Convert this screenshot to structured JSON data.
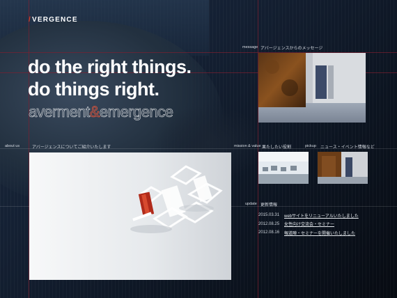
{
  "brand": {
    "logo_slash": "/",
    "logo_text": "VERGENCE"
  },
  "hero": {
    "headline_line1": "do the right things.",
    "headline_line2": "do things right.",
    "tagline_part1": "averment",
    "tagline_amp": "&",
    "tagline_part2": "emergence"
  },
  "sections": {
    "message": {
      "label": "message",
      "title": "アバージェンスからのメッセージ"
    },
    "about": {
      "label": "about us",
      "title": "アバージェンスについてご紹介いたします"
    },
    "mission": {
      "label": "mission & value",
      "title": "果たしたい役割"
    },
    "pickup": {
      "label": "pickup",
      "title": "ニュース・イベント情報など"
    },
    "update": {
      "label": "update",
      "title": "更新情報"
    }
  },
  "updates": [
    {
      "date": "2015.03.31",
      "title": "webサイトをリニューアルいたしました"
    },
    {
      "date": "2012.08.25",
      "title": "女性向け交流会・セミナー"
    },
    {
      "date": "2012.08.16",
      "title": "報道陣・セミナーを開催いたしました"
    }
  ],
  "colors": {
    "accent": "#d9412a",
    "guide": "#7d2030",
    "background": "#0d1724"
  }
}
